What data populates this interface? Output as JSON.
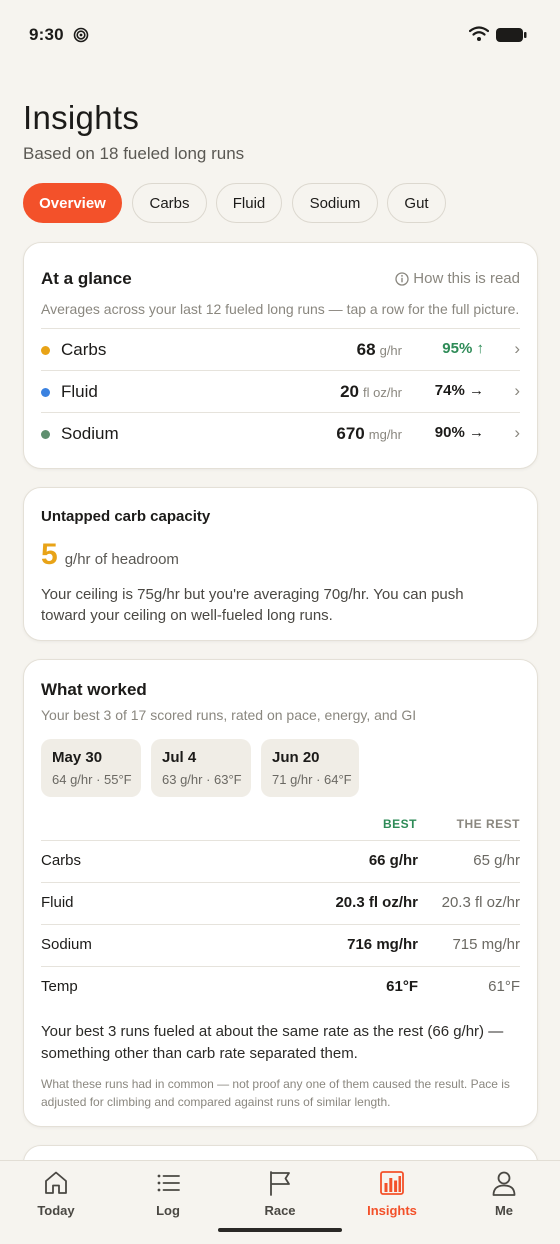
{
  "status": {
    "time": "9:30"
  },
  "header": {
    "title": "Insights",
    "subtitle": "Based on 18 fueled long runs"
  },
  "tabs": [
    {
      "label": "Overview",
      "active": true
    },
    {
      "label": "Carbs"
    },
    {
      "label": "Fluid"
    },
    {
      "label": "Sodium"
    },
    {
      "label": "Gut"
    }
  ],
  "glance": {
    "title": "At a glance",
    "help": "How this is read",
    "description": "Averages across your last 12 fueled long runs — tap a row for the full picture.",
    "rows": [
      {
        "name": "Carbs",
        "value": "68",
        "unit": "g/hr",
        "pct": "95% ↑",
        "color": "#e8a317",
        "pct_color": "#2e8b57"
      },
      {
        "name": "Fluid",
        "value": "20",
        "unit": "fl oz/hr",
        "pct": "74% →",
        "color": "#3b82e0",
        "pct_color": "#1c1b19"
      },
      {
        "name": "Sodium",
        "value": "670",
        "unit": "mg/hr",
        "pct": "90% →",
        "color": "#5f8f6f",
        "pct_color": "#1c1b19"
      }
    ]
  },
  "capacity": {
    "title": "Untapped carb capacity",
    "big_number": "5",
    "big_caption": "g/hr of headroom",
    "body": "Your ceiling is 75g/hr but you're averaging 70g/hr. You can push toward your ceiling on well-fueled long runs."
  },
  "worked": {
    "title": "What worked",
    "subtitle": "Your best 3 of 17 scored runs, rated on pace, energy, and GI",
    "runs": [
      {
        "date": "May 30",
        "stats": "64 g/hr · 55°F"
      },
      {
        "date": "Jul 4",
        "stats": "63 g/hr · 63°F"
      },
      {
        "date": "Jun 20",
        "stats": "71 g/hr · 64°F"
      }
    ],
    "col_best": "BEST",
    "col_rest": "THE REST",
    "rows": [
      {
        "name": "Carbs",
        "best": "66 g/hr",
        "rest": "65 g/hr"
      },
      {
        "name": "Fluid",
        "best": "20.3 fl oz/hr",
        "rest": "20.3 fl oz/hr"
      },
      {
        "name": "Sodium",
        "best": "716 mg/hr",
        "rest": "715 mg/hr"
      },
      {
        "name": "Temp",
        "best": "61°F",
        "rest": "61°F"
      }
    ],
    "summary": "Your best 3 runs fueled at about the same rate as the rest (66 g/hr) — something other than carb rate separated them.",
    "note": "What these runs had in common — not proof any one of them caused the result. Pace is adjusted for climbing and compared against runs of similar length."
  },
  "nav": [
    {
      "label": "Today",
      "icon": "home-icon"
    },
    {
      "label": "Log",
      "icon": "list-icon"
    },
    {
      "label": "Race",
      "icon": "flag-icon"
    },
    {
      "label": "Insights",
      "icon": "bar-chart-icon",
      "active": true
    },
    {
      "label": "Me",
      "icon": "person-icon"
    }
  ],
  "colors": {
    "accent": "#f3512a",
    "best": "#2e8b57",
    "headroom": "#e8a317"
  }
}
